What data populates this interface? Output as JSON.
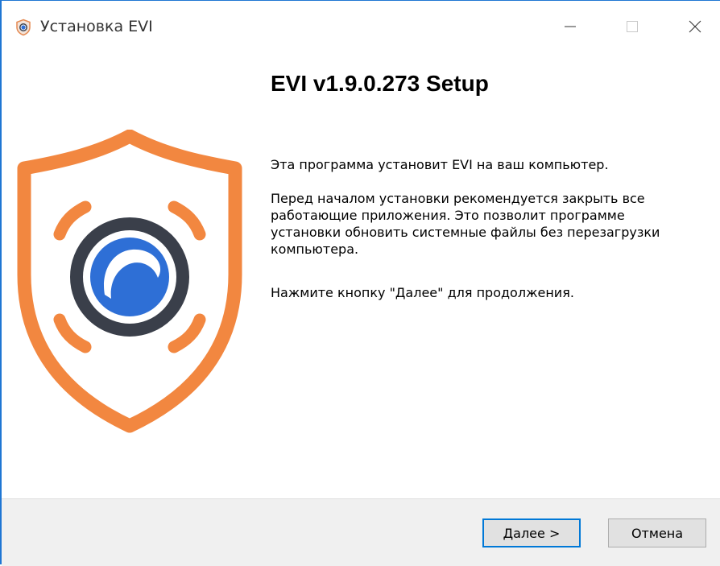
{
  "window": {
    "title": "Установка EVI",
    "accent_color": "#1f76d3"
  },
  "header": {
    "heading": "EVI v1.9.0.273 Setup"
  },
  "body": {
    "paragraph1": "Эта программа установит EVI на ваш компьютер.",
    "paragraph2": "Перед началом установки рекомендуется закрыть все работающие приложения. Это позволит программе установки обновить системные файлы без перезагрузки компьютера.",
    "paragraph3": "Нажмите кнопку \"Далее\" для продолжения."
  },
  "logo": {
    "icon": "evi-shield-logo",
    "shield_color": "#f28740",
    "ring_color": "#3a3f4a",
    "center_color": "#2e6fd6"
  },
  "buttons": {
    "next_label": "Далее >",
    "cancel_label": "Отмена"
  }
}
